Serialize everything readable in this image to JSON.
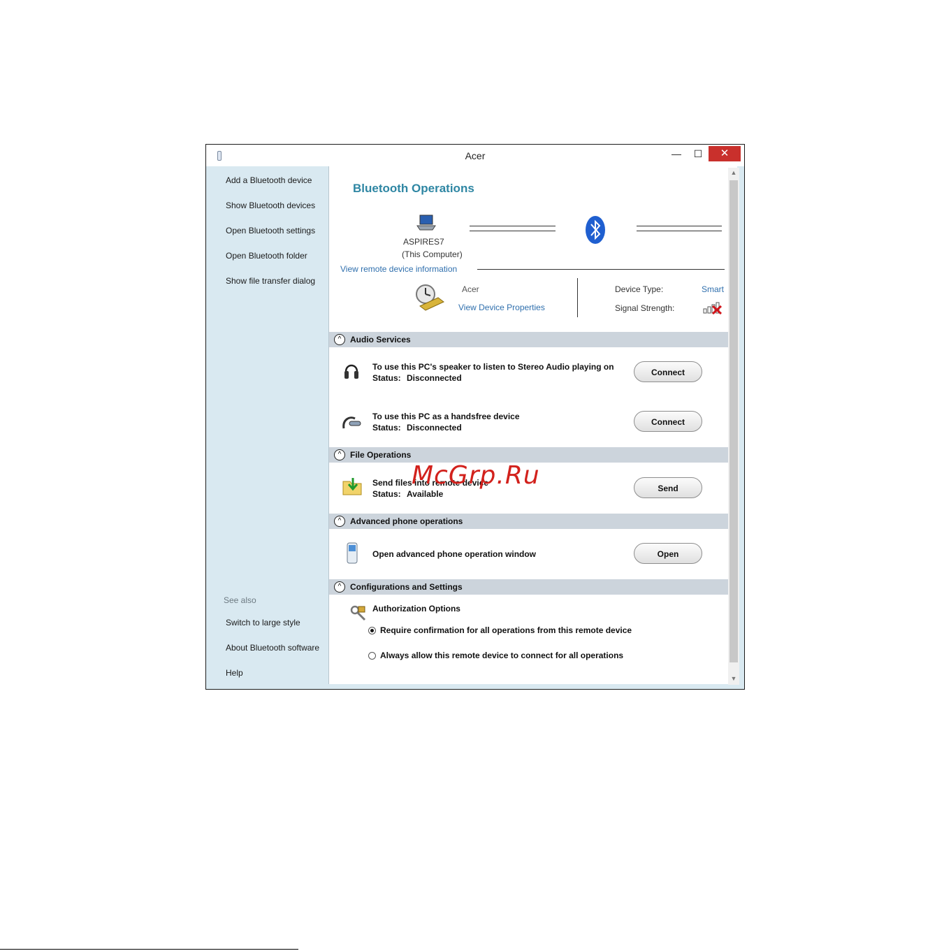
{
  "window": {
    "title": "Acer",
    "minimize_glyph": "—",
    "maximize_glyph": "☐",
    "close_glyph": "✕"
  },
  "sidebar": {
    "items": [
      {
        "label": "Add a Bluetooth device"
      },
      {
        "label": "Show Bluetooth devices"
      },
      {
        "label": "Open Bluetooth settings"
      },
      {
        "label": "Open Bluetooth folder"
      },
      {
        "label": "Show file transfer dialog"
      }
    ],
    "see_also_header": "See also",
    "see_also": [
      {
        "label": "Switch to large style"
      },
      {
        "label": "About Bluetooth software"
      },
      {
        "label": "Help"
      }
    ]
  },
  "main": {
    "heading": "Bluetooth Operations",
    "computer": {
      "name": "ASPIRES7",
      "subtitle": "(This Computer)"
    },
    "view_remote_info": "View remote device information",
    "remote": {
      "name": "Acer",
      "view_properties": "View Device Properties",
      "device_type_label": "Device Type:",
      "device_type_value": "Smart",
      "signal_label": "Signal Strength:"
    },
    "sections": {
      "audio": {
        "title": "Audio Services",
        "stereo": {
          "text": "To use this PC's speaker to listen to Stereo Audio playing on",
          "status_label": "Status:",
          "status_value": "Disconnected",
          "button": "Connect"
        },
        "handsfree": {
          "text": "To use this PC as a handsfree device",
          "status_label": "Status:",
          "status_value": "Disconnected",
          "button": "Connect"
        }
      },
      "file": {
        "title": "File Operations",
        "send": {
          "text": "Send files into remote device",
          "status_label": "Status:",
          "status_value": "Available",
          "button": "Send"
        }
      },
      "phone": {
        "title": "Advanced phone operations",
        "open": {
          "text": "Open advanced phone operation window",
          "button": "Open"
        }
      },
      "config": {
        "title": "Configurations and Settings",
        "auth_title": "Authorization Options",
        "options": [
          {
            "label": "Require confirmation for all operations from this remote device",
            "selected": true
          },
          {
            "label": "Always allow this remote device to connect for all operations",
            "selected": false
          }
        ]
      }
    }
  },
  "watermark": "McGrp.Ru",
  "colors": {
    "accent": "#2e86a3",
    "link": "#2f6fad",
    "sidebar_bg": "#d9e9f1",
    "section_header": "#ccd4dc",
    "close_red": "#c9302c",
    "watermark": "#d2211c"
  }
}
